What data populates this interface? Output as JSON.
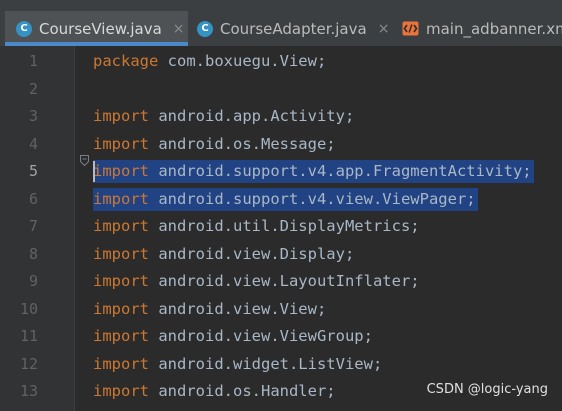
{
  "tabs": [
    {
      "label": "CourseView.java",
      "icon": "class-icon",
      "close": "×",
      "active": true
    },
    {
      "label": "CourseAdapter.java",
      "icon": "class-icon",
      "close": "×",
      "active": false
    },
    {
      "label": "main_adbanner.xml",
      "icon": "xml-icon",
      "close": "",
      "active": false
    }
  ],
  "editor": {
    "lines": [
      {
        "num": "1",
        "kw": "package",
        "rest": " com.boxuegu.View;"
      },
      {
        "num": "2",
        "kw": "",
        "rest": ""
      },
      {
        "num": "3",
        "kw": "import",
        "rest": " android.app.Activity;"
      },
      {
        "num": "4",
        "kw": "import",
        "rest": " android.os.Message;"
      },
      {
        "num": "5",
        "kw": "import",
        "rest": " android.support.v4.app.FragmentActivity;"
      },
      {
        "num": "6",
        "kw": "import",
        "rest": " android.support.v4.view.ViewPager;"
      },
      {
        "num": "7",
        "kw": "import",
        "rest": " android.util.DisplayMetrics;"
      },
      {
        "num": "8",
        "kw": "import",
        "rest": " android.view.Display;"
      },
      {
        "num": "9",
        "kw": "import",
        "rest": " android.view.LayoutInflater;"
      },
      {
        "num": "10",
        "kw": "import",
        "rest": " android.view.View;"
      },
      {
        "num": "11",
        "kw": "import",
        "rest": " android.view.ViewGroup;"
      },
      {
        "num": "12",
        "kw": "import",
        "rest": " android.widget.ListView;"
      },
      {
        "num": "13",
        "kw": "import",
        "rest": " android.os.Handler;"
      }
    ],
    "current_line": "5",
    "selected_lines": [
      "5",
      "6"
    ]
  },
  "watermark": "CSDN @logic-yang",
  "colors": {
    "keyword": "#cc7832",
    "identifier": "#a9b7c6",
    "selection": "#214283",
    "tab_accent": "#4a88c7",
    "class_icon": "#3592c4"
  }
}
